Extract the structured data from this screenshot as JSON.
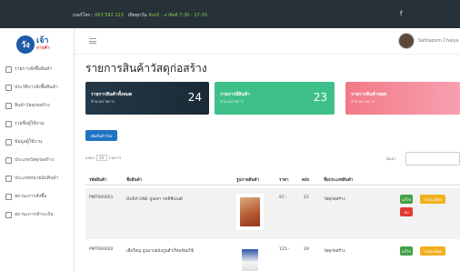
{
  "topbar": {
    "contact_label": "เบอร์โทร :",
    "phone": "063 592 123",
    "hours_label": "เปิดทุกวัน",
    "hours": "จันทร์ - อาทิตย์ 7:30 - 17:30",
    "facebook_icon": "f"
  },
  "logo": {
    "mark": "วัง",
    "word": "เจ้า",
    "sub": "การค้า"
  },
  "sidebar": {
    "items": [
      {
        "label": "รายการสั่งซื้อสินค้า",
        "icon": "cart-icon"
      },
      {
        "label": "ประวัติการสั่งซื้อสินค้า",
        "icon": "history-icon"
      },
      {
        "label": "สินค้าวัสดุก่อสร้าง",
        "icon": "tools-icon"
      },
      {
        "label": "รายชื่อผู้ใช้งาน",
        "icon": "users-icon"
      },
      {
        "label": "ข้อมูลผู้ใช้งาน",
        "icon": "user-icon"
      },
      {
        "label": "ประเภทวัสดุก่อสร้าง",
        "icon": "category-icon"
      },
      {
        "label": "ประเภทหน่วยนับสินค้า",
        "icon": "unit-icon"
      },
      {
        "label": "สถานะการสั่งซื้อ",
        "icon": "status-icon"
      },
      {
        "label": "สถานะการชำระเงิน",
        "icon": "payment-icon"
      }
    ]
  },
  "header": {
    "username": "Sathaporn Chaiya"
  },
  "page": {
    "title": "รายการสินค้าวัสดุก่อสร้าง",
    "add_button": "เพิ่มสินค้าใหม่",
    "show_label": "แสดง",
    "show_value": "10",
    "show_suffix": "รายการ",
    "search_label": "ค้นหา:"
  },
  "cards": [
    {
      "title": "รายการสินค้าทั้งหมด",
      "subtitle": "จำนวนรายการ",
      "value": "24",
      "color": "#243848"
    },
    {
      "title": "รายการมีสินค้า",
      "subtitle": "จำนวนรายการ",
      "value": "23",
      "color": "#3fc08a"
    },
    {
      "title": "รายการสินค้าหมด",
      "subtitle": "จำนวนรายการ",
      "value": "",
      "color": "#f27a86"
    }
  ],
  "table": {
    "columns": [
      "รหัสสินค้า",
      "ชื่อสินค้า",
      "รูปภาพสินค้า",
      "ราคา",
      "คลัง",
      "ชื่อประเภทสินค้า"
    ],
    "rows": [
      {
        "code": "PMT000001",
        "name": "DURA ONE ปูนเทา ปกติซีเมนต์",
        "price": "97.-",
        "stock": "21",
        "type": "วัสดุก่อสร้าง"
      },
      {
        "code": "PMT000002",
        "name": "เสือใหญ่ ปูนฉาบผนังปูนสำเร็จพร้อมใช้",
        "price": "125.-",
        "stock": "29",
        "type": "วัสดุก่อสร้าง"
      }
    ],
    "actions": {
      "edit": "แก้ไข",
      "detail": "รายละเอียด",
      "delete": "ลบ"
    }
  }
}
